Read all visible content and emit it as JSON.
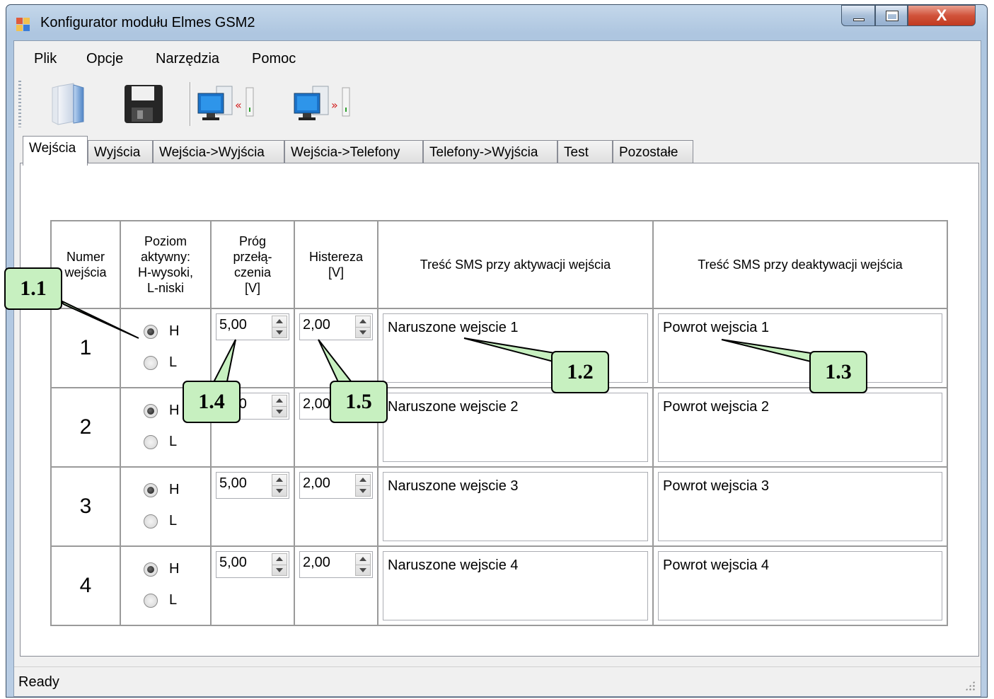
{
  "window": {
    "title": "Konfigurator modułu Elmes GSM2",
    "close_glyph": "X"
  },
  "menu": [
    "Plik",
    "Opcje",
    "Narzędzia",
    "Pomoc"
  ],
  "toolbar": [
    "open-file-icon",
    "save-floppy-icon",
    "read-from-device-icon",
    "write-to-device-icon"
  ],
  "tabs": [
    "Wejścia",
    "Wyjścia",
    "Wejścia->Wyjścia",
    "Wejścia->Telefony",
    "Telefony->Wyjścia",
    "Test",
    "Pozostałe"
  ],
  "active_tab": "Wejścia",
  "columns": {
    "numer": [
      "Numer",
      "wejścia"
    ],
    "poziom": [
      "Poziom",
      "aktywny:",
      "H-wysoki,",
      "L-niski"
    ],
    "prog": [
      "Próg",
      "przełą-",
      "czenia",
      "[V]"
    ],
    "histereza": [
      "Histereza",
      "[V]"
    ],
    "sms_on": "Treść SMS przy aktywacji wejścia",
    "sms_off": "Treść SMS przy deaktywacji wejścia"
  },
  "radio_labels": [
    "H",
    "L"
  ],
  "rows": [
    {
      "num": "1",
      "level": "H",
      "prog": "5,00",
      "hist": "2,00",
      "sms_on": "Naruszone wejscie 1",
      "sms_off": "Powrot wejscia 1"
    },
    {
      "num": "2",
      "level": "H",
      "prog": "5,00",
      "hist": "2,00",
      "sms_on": "Naruszone wejscie 2",
      "sms_off": "Powrot wejscia 2"
    },
    {
      "num": "3",
      "level": "H",
      "prog": "5,00",
      "hist": "2,00",
      "sms_on": "Naruszone wejscie 3",
      "sms_off": "Powrot wejscia 3"
    },
    {
      "num": "4",
      "level": "H",
      "prog": "5,00",
      "hist": "2,00",
      "sms_on": "Naruszone wejscie 4",
      "sms_off": "Powrot wejscia 4"
    }
  ],
  "status": "Ready",
  "callouts": [
    "1.1",
    "1.2",
    "1.3",
    "1.4",
    "1.5"
  ],
  "colors": {
    "callout_fill": "#c7f0c0",
    "title_band": "#b9cde4"
  }
}
